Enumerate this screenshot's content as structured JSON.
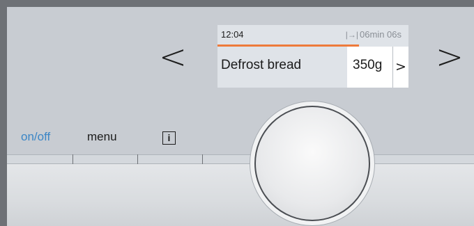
{
  "navigation": {
    "prev_symbol": "<",
    "next_symbol": ">"
  },
  "display": {
    "clock": "12:04",
    "timer_icon": "|→|",
    "timer": "06min 06s",
    "progress_fraction": 0.74,
    "program": "Defrost bread",
    "weight": "350g",
    "weight_arrow": ">"
  },
  "buttons": {
    "onoff_label": "on/off",
    "menu_label": "menu",
    "info_symbol": "i"
  },
  "colors": {
    "accent_blue": "#3b86c6",
    "progress_orange": "#ee7a3b"
  },
  "icons": {
    "info": "info-icon",
    "timer": "timer-end-icon",
    "knob": "control-knob"
  }
}
